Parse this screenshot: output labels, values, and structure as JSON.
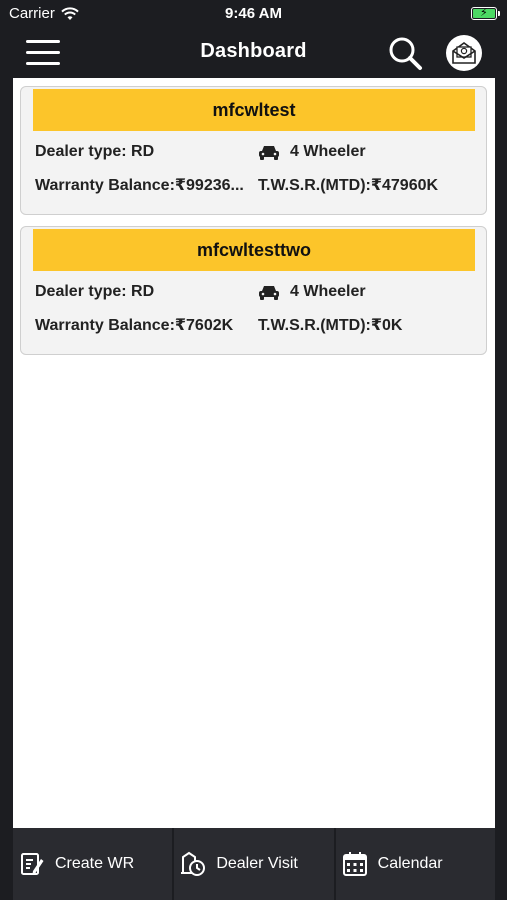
{
  "status_bar": {
    "carrier": "Carrier",
    "time": "9:46 AM"
  },
  "header": {
    "title": "Dashboard"
  },
  "dealers": [
    {
      "name": "mfcwltest",
      "dealer_type": "Dealer type: RD",
      "vehicle": "4 Wheeler",
      "warranty_balance": "Warranty Balance:₹99236...",
      "twsr": "T.W.S.R.(MTD):₹47960K"
    },
    {
      "name": "mfcwltesttwo",
      "dealer_type": "Dealer type: RD",
      "vehicle": "4 Wheeler",
      "warranty_balance": "Warranty Balance:₹7602K",
      "twsr": "T.W.S.R.(MTD):₹0K"
    }
  ],
  "tabs": [
    {
      "label": "Create WR",
      "icon": "create-wr-icon"
    },
    {
      "label": "Dealer Visit",
      "icon": "dealer-visit-icon"
    },
    {
      "label": "Calendar",
      "icon": "calendar-icon"
    }
  ],
  "colors": {
    "background": "#1c1d21",
    "card_header": "#fcc52a",
    "tab_bar": "#2a2b30",
    "battery": "#4cd964"
  }
}
